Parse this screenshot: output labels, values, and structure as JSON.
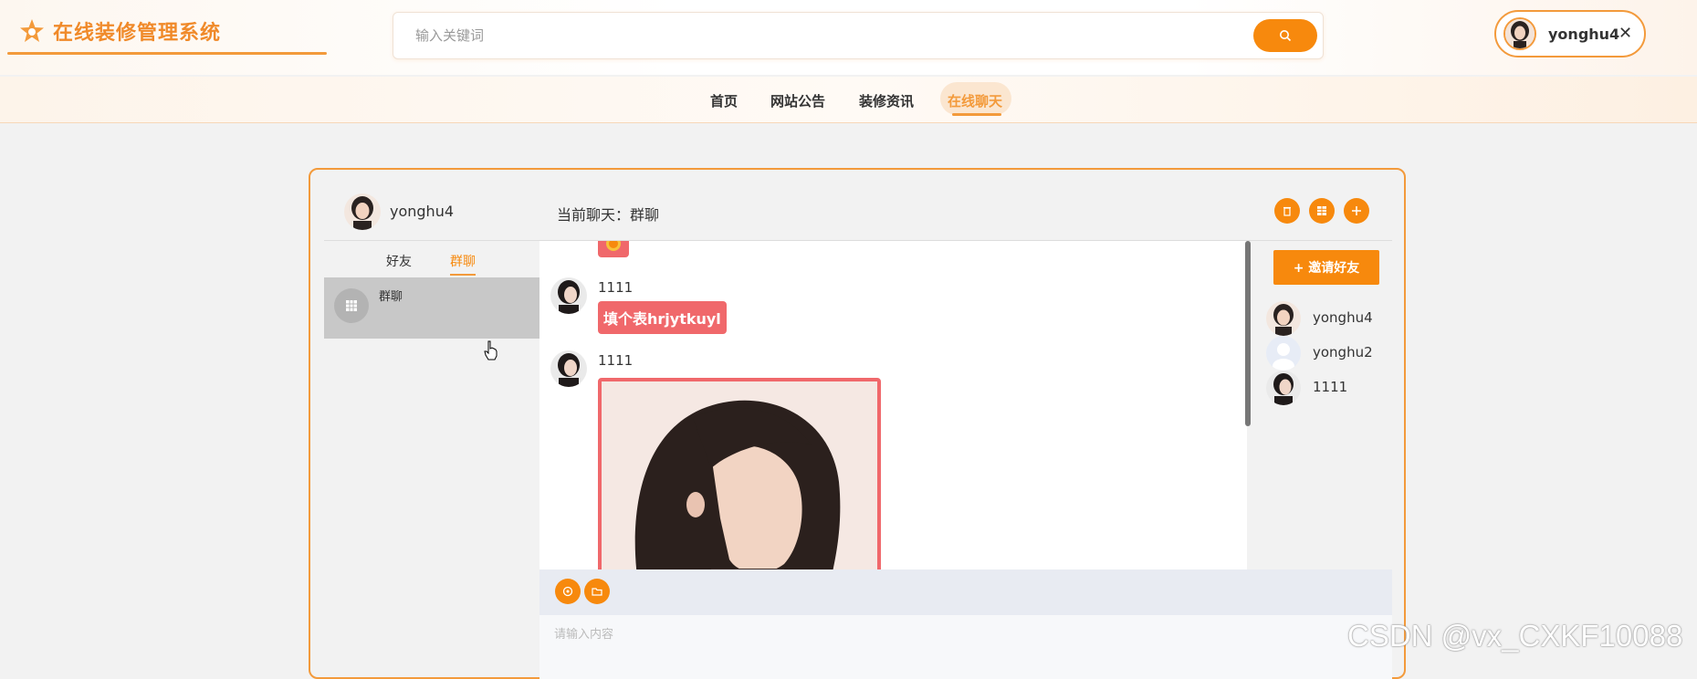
{
  "header": {
    "app_title": "在线装修管理系统",
    "search_placeholder": "输入关键词",
    "user_name": "yonghu4"
  },
  "nav": {
    "items": [
      "首页",
      "网站公告",
      "装修资讯",
      "在线聊天"
    ],
    "active_index": 3
  },
  "chat": {
    "current_user": "yonghu4",
    "current_chat_label": "当前聊天：群聊",
    "tabs": [
      "好友",
      "群聊"
    ],
    "active_tab": "群聊",
    "conversations": [
      {
        "name": "群聊"
      }
    ],
    "messages": [
      {
        "sender": "1111",
        "type": "text",
        "text": "填个表hrjytkuyl"
      },
      {
        "sender": "1111",
        "type": "image"
      }
    ],
    "invite_label": "+ 邀请好友",
    "members": [
      "yonghu4",
      "yonghu2",
      "1111"
    ],
    "input_placeholder": "请输入内容"
  },
  "watermark": "CSDN @vx_CXKF10088",
  "colors": {
    "accent": "#f7890d",
    "bubble": "#f0686b"
  }
}
